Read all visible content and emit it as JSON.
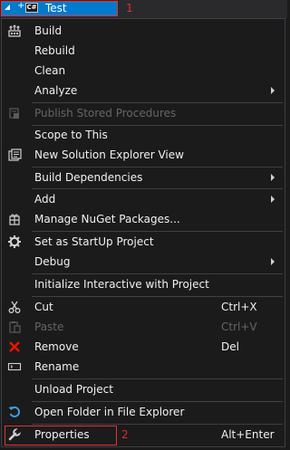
{
  "tree": {
    "project_name": "Test",
    "project_type_label": "C#",
    "expander_symbol": "+",
    "annotation_1": "1"
  },
  "menu": {
    "items": [
      {
        "label": "Build"
      },
      {
        "label": "Rebuild"
      },
      {
        "label": "Clean"
      },
      {
        "label": "Analyze"
      },
      {
        "label": "Publish Stored Procedures"
      },
      {
        "label": "Scope to This"
      },
      {
        "label": "New Solution Explorer View"
      },
      {
        "label": "Build Dependencies"
      },
      {
        "label": "Add"
      },
      {
        "label": "Manage NuGet Packages..."
      },
      {
        "label": "Set as StartUp Project"
      },
      {
        "label": "Debug"
      },
      {
        "label": "Initialize Interactive with Project"
      },
      {
        "label": "Cut",
        "shortcut": "Ctrl+X"
      },
      {
        "label": "Paste",
        "shortcut": "Ctrl+V"
      },
      {
        "label": "Remove",
        "shortcut": "Del"
      },
      {
        "label": "Rename"
      },
      {
        "label": "Unload Project"
      },
      {
        "label": "Open Folder in File Explorer"
      },
      {
        "label": "Properties",
        "shortcut": "Alt+Enter"
      }
    ],
    "annotation_2": "2"
  },
  "icons": {
    "build": "build-icon",
    "publish": "publish-icon",
    "new_view": "new-view-icon",
    "nuget": "nuget-icon",
    "startup": "gear-icon",
    "cut": "scissors-icon",
    "paste": "paste-icon",
    "remove": "remove-x-icon",
    "rename": "rename-icon",
    "open_folder": "refresh-folder-icon",
    "properties": "wrench-icon"
  },
  "colors": {
    "selection": "#007acc",
    "annotation": "#e03333",
    "menu_bg": "#1b1b1c",
    "disabled_text": "#656565",
    "remove_icon": "#e51400"
  }
}
